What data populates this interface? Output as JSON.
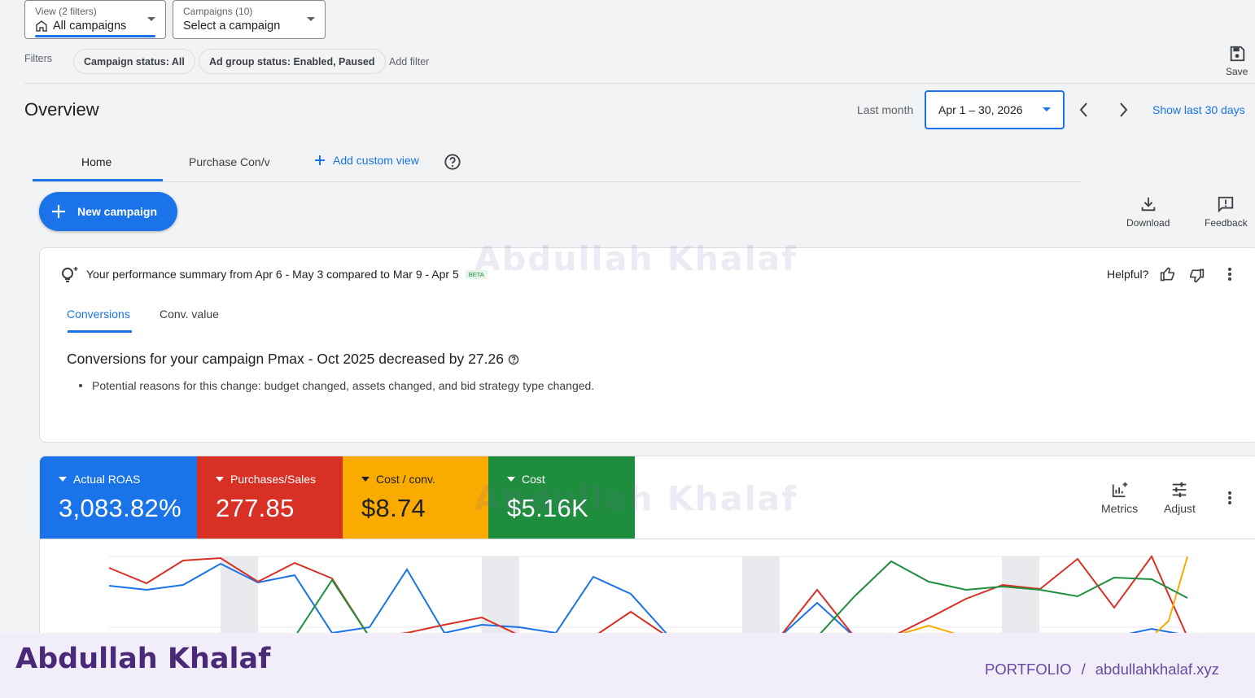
{
  "view_selector": {
    "small": "View (2 filters)",
    "main": "All campaigns"
  },
  "campaign_selector": {
    "small": "Campaigns (10)",
    "main": "Select a campaign"
  },
  "filters": {
    "label": "Filters",
    "chips": [
      "Campaign status: All",
      "Ad group status: Enabled, Paused"
    ],
    "add_filter": "Add filter"
  },
  "save_label": "Save",
  "overview": {
    "title": "Overview",
    "last_month": "Last month",
    "date_range": "Apr 1 – 30, 2026",
    "show_last": "Show last 30 days"
  },
  "tabs": {
    "home": "Home",
    "purchase": "Purchase Con/v",
    "add_custom": "Add custom view"
  },
  "new_campaign": "New campaign",
  "download_label": "Download",
  "feedback_label": "Feedback",
  "summary": {
    "title": "Your performance summary from Apr 6 - May 3 compared to Mar 9 - Apr 5",
    "beta": "BETA",
    "helpful": "Helpful?",
    "tabs": [
      "Conversions",
      "Conv. value"
    ],
    "headline": "Conversions for your campaign Pmax - Oct 2025 decreased by 27.26",
    "reason": "Potential reasons for this change: budget changed, assets changed, and bid strategy type changed."
  },
  "metrics": [
    {
      "label": "Actual ROAS",
      "value": "3,083.82%",
      "color": "#1a73e8"
    },
    {
      "label": "Purchases/Sales",
      "value": "277.85",
      "color": "#d93025"
    },
    {
      "label": "Cost / conv.",
      "value": "$8.74",
      "color": "#f9ab00"
    },
    {
      "label": "Cost",
      "value": "$5.16K",
      "color": "#1e8e3e"
    }
  ],
  "metrics_btn": "Metrics",
  "adjust_btn": "Adjust",
  "watermark": "Abdullah Khalaf",
  "footer": {
    "name": "Abdullah Khalaf",
    "portfolio": "PORTFOLIO",
    "separator": "/",
    "site": "abdullahkhalaf.xyz"
  }
}
